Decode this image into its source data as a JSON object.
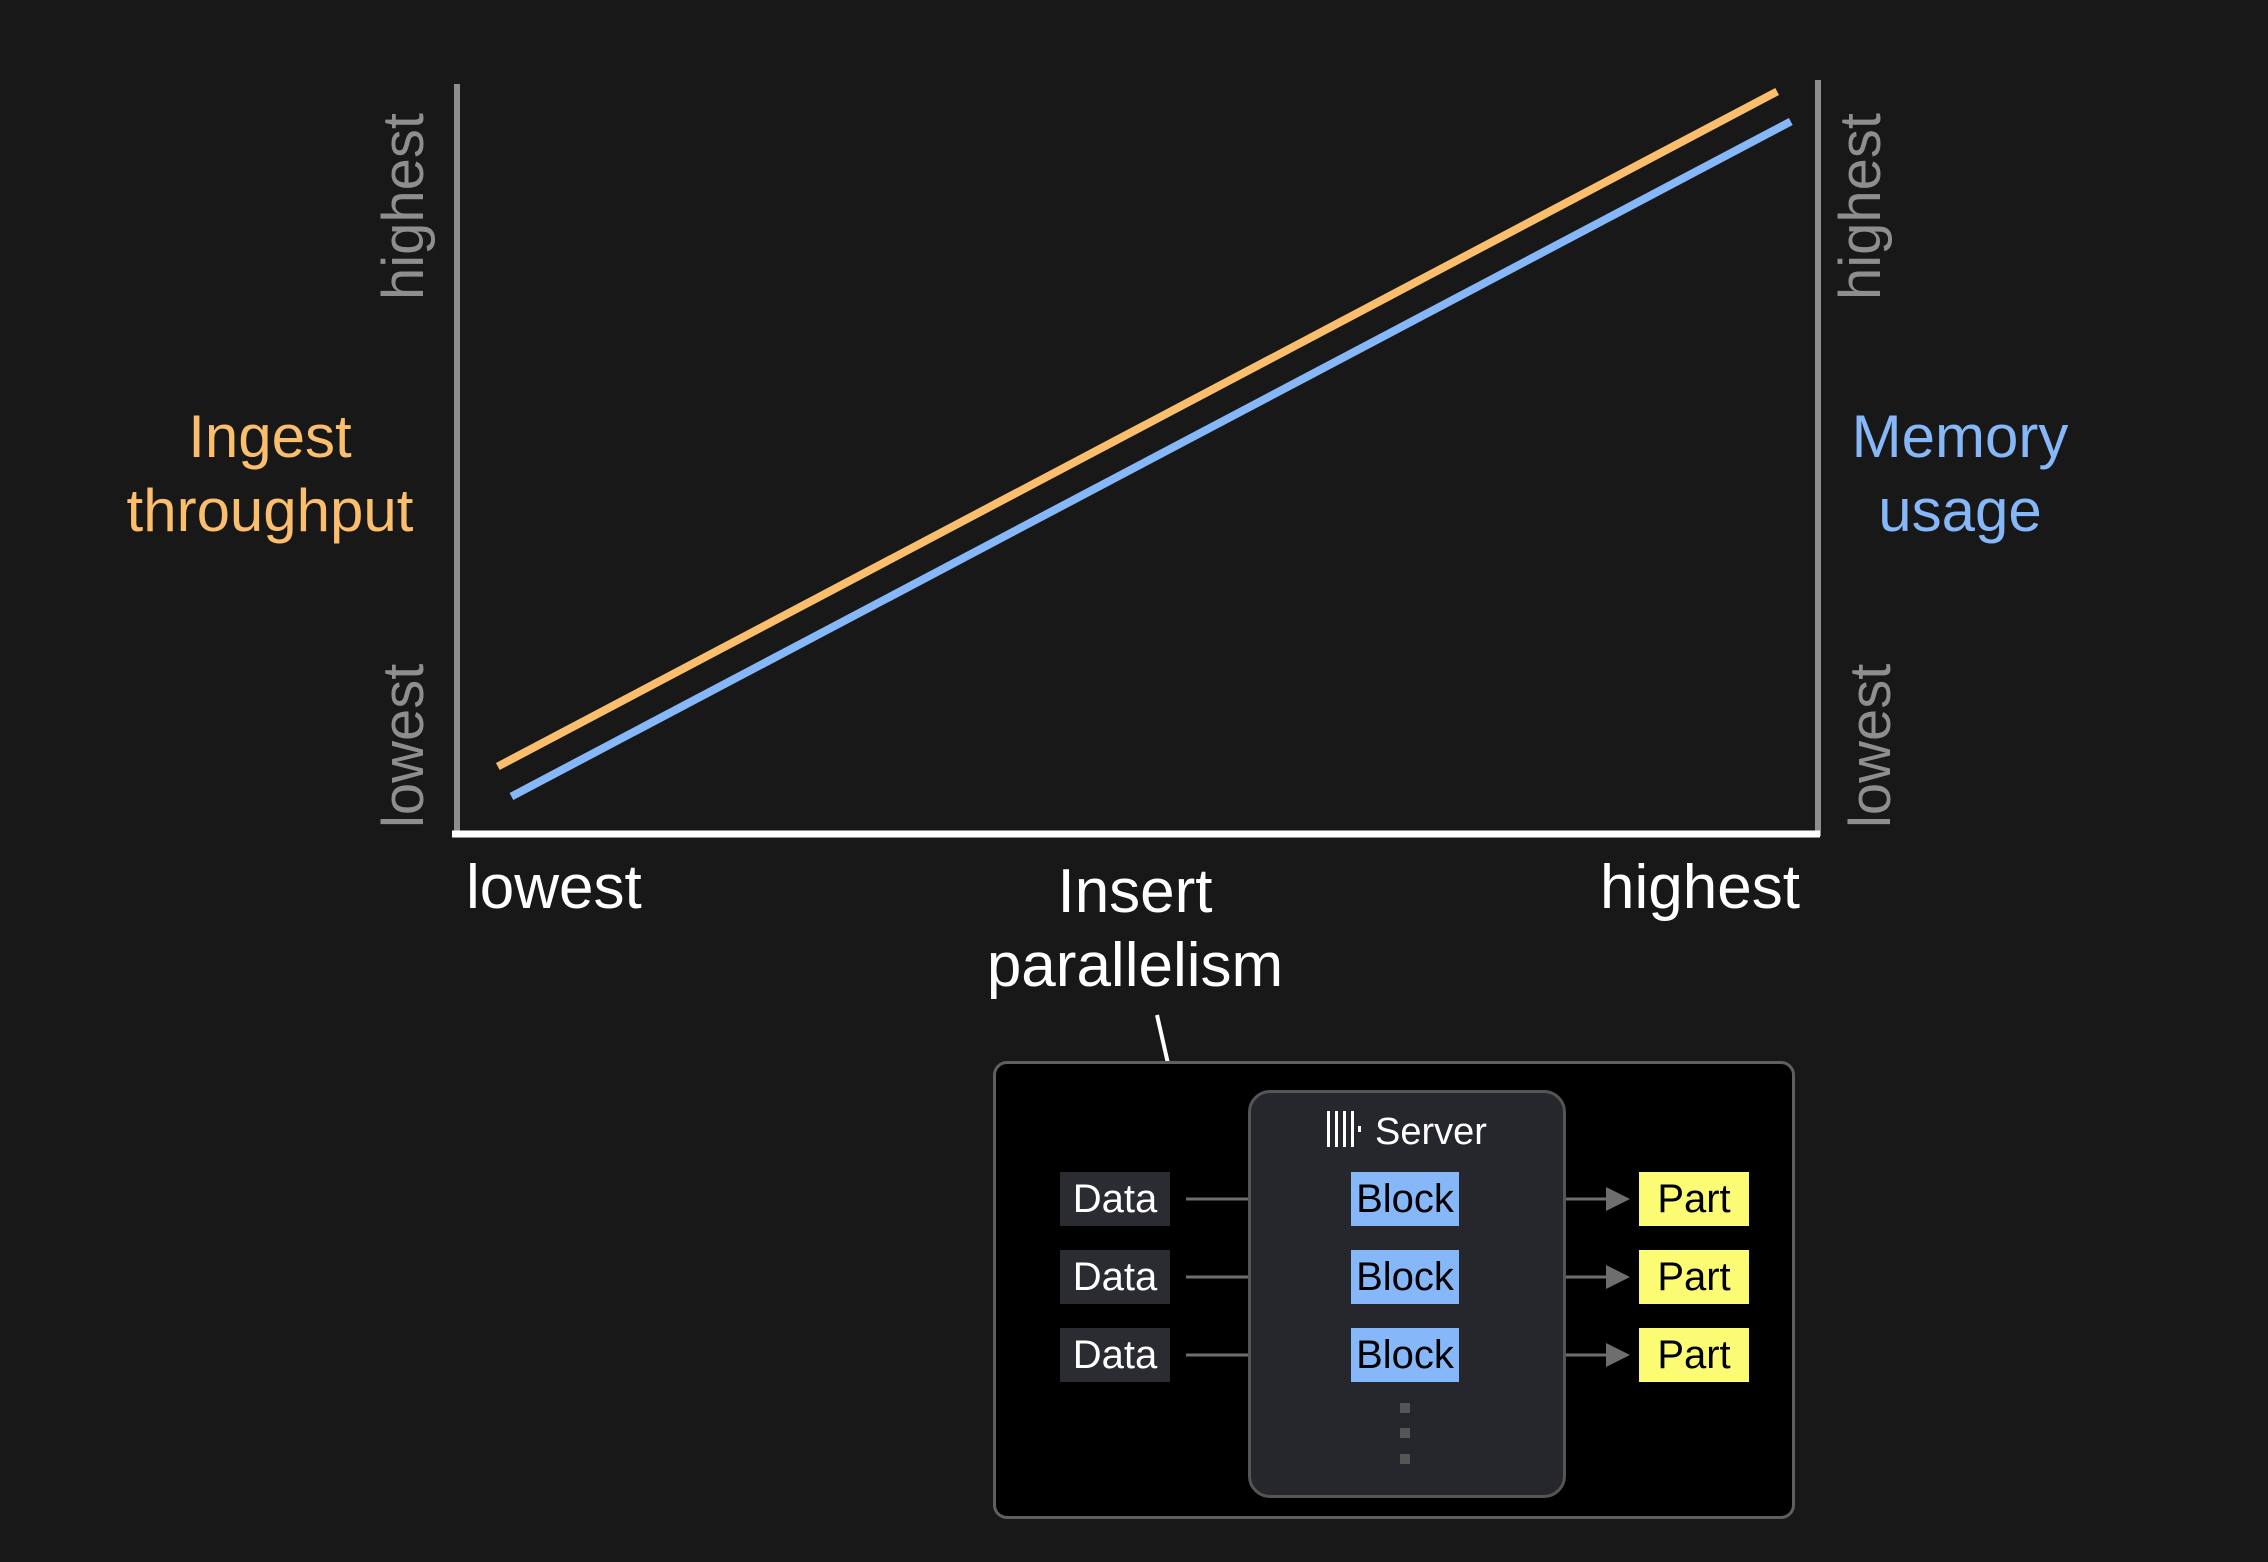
{
  "chart_data": {
    "type": "line",
    "title": "",
    "xlabel": "Insert parallelism",
    "x_tick_labels": [
      "lowest",
      "highest"
    ],
    "y_left_label": "Ingest throughput",
    "y_left_tick_labels": [
      "lowest",
      "highest"
    ],
    "y_right_label": "Memory usage",
    "y_right_tick_labels": [
      "lowest",
      "highest"
    ],
    "xlim": [
      0,
      1
    ],
    "ylim": [
      0,
      1
    ],
    "grid": false,
    "series": [
      {
        "name": "Ingest throughput",
        "color": "#fbbe6d",
        "axis": "left",
        "x": [
          0.03,
          0.97
        ],
        "y": [
          0.09,
          0.99
        ]
      },
      {
        "name": "Memory usage",
        "color": "#85b7f9",
        "axis": "right",
        "x": [
          0.04,
          0.98
        ],
        "y": [
          0.05,
          0.95
        ]
      }
    ]
  },
  "colors": {
    "background": "#181818",
    "axis_left_right": "#8e8e8e",
    "axis_bottom": "#ffffff",
    "throughput": "#fbbe6d",
    "memory": "#85b7f9"
  },
  "labels": {
    "left_title_line1": "Ingest",
    "left_title_line2": "throughput",
    "right_title_line1": "Memory",
    "right_title_line2": "usage",
    "x_low": "lowest",
    "x_high": "highest",
    "x_title_line1": "Insert",
    "x_title_line2": "parallelism"
  },
  "diagram": {
    "server_icon": "clickhouse-bars-icon",
    "server_label": "Server",
    "rows": [
      {
        "data": "Data",
        "block": "Block",
        "part": "Part"
      },
      {
        "data": "Data",
        "block": "Block",
        "part": "Part"
      },
      {
        "data": "Data",
        "block": "Block",
        "part": "Part"
      }
    ],
    "more_indicator": "vertical-ellipsis"
  }
}
